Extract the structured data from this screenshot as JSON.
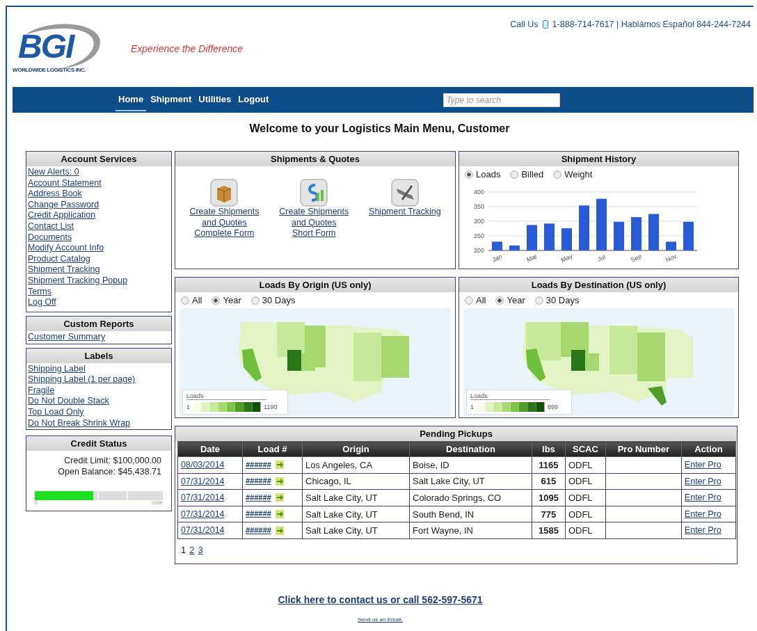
{
  "header": {
    "logo_text": "BGI",
    "logo_subtitle": "WORLDWIDE LOGISTICS INC.",
    "tagline": "Experience the Difference",
    "call_label": "Call Us",
    "phone": "1-888-714-7617 | Hablámos Español 844-244-7244"
  },
  "nav": {
    "items": [
      {
        "label": "Home",
        "selected": true
      },
      {
        "label": "Shipment",
        "selected": false
      },
      {
        "label": "Utilities",
        "selected": false
      },
      {
        "label": "Logout",
        "selected": false
      }
    ],
    "search": {
      "placeholder": "Type to search"
    }
  },
  "welcome": "Welcome to your Logistics Main Menu, Customer",
  "account_services": {
    "title": "Account Services",
    "links": [
      "New Alerts: 0 ",
      "Account Statement",
      "Address Book",
      "Change Password",
      "Credit Application",
      "Contact List",
      "Documents",
      "Modify Account Info",
      "Product Catalog",
      "Shipment Tracking",
      "Shipment Tracking Popup",
      "Terms",
      "Log Off"
    ]
  },
  "custom_reports": {
    "title": "Custom Reports",
    "links": [
      "Customer Summary"
    ]
  },
  "labels": {
    "title": "Labels",
    "links": [
      "Shipping Label",
      "Shipping Label (1 per page)",
      "Fragile",
      "Do Not Double Stack",
      "Top Load Only",
      "Do Not Break Shrink Wrap"
    ]
  },
  "credit_status": {
    "title": "Credit Status",
    "credit_limit": "Credit Limit: $100,000.00",
    "open_balance": "Open Balance: $45,438.71",
    "level": 0.454,
    "min_label": "0",
    "max_label": "100K"
  },
  "shipments_quotes": {
    "title": "Shipments & Quotes",
    "actions": [
      {
        "kind": "box",
        "lines": [
          "Create Shipments",
          "and Quotes",
          "Complete Form"
        ]
      },
      {
        "kind": "money",
        "lines": [
          "Create Shipments",
          "and Quotes",
          "Short Form"
        ]
      },
      {
        "kind": "tracking",
        "lines": [
          "Shipment Tracking"
        ]
      }
    ]
  },
  "shipment_history": {
    "title": "Shipment History",
    "options": [
      {
        "label": "Loads",
        "selected": true
      },
      {
        "label": "Billed",
        "selected": false
      },
      {
        "label": "Weight",
        "selected": false
      }
    ],
    "chart_data": {
      "type": "bar",
      "categories": [
        "Jan",
        null,
        "Mar",
        null,
        "May",
        null,
        "Jul",
        null,
        "Sep",
        null,
        "Nov",
        null
      ],
      "series": [
        {
          "color": "#2a5bd7",
          "values": [
            230,
            217,
            287,
            292,
            276,
            354,
            377,
            298,
            314,
            325,
            230,
            298
          ]
        }
      ],
      "ylim": [
        200,
        400
      ],
      "yticks": [
        200,
        250,
        300,
        350,
        400
      ],
      "grid": true
    }
  },
  "maps": [
    {
      "title": "Loads By Origin (US only)",
      "options": [
        {
          "label": "All",
          "selected": false
        },
        {
          "label": "Year",
          "selected": true
        },
        {
          "label": "30 Days",
          "selected": false
        }
      ],
      "legend": {
        "title": "Loads",
        "min": "1",
        "max": "1190"
      }
    },
    {
      "title": "Loads By Destination (US only)",
      "options": [
        {
          "label": "All",
          "selected": false
        },
        {
          "label": "Year",
          "selected": true
        },
        {
          "label": "30 Days",
          "selected": false
        }
      ],
      "legend": {
        "title": "Loads",
        "min": "1",
        "max": "899"
      }
    }
  ],
  "pending_pickups": {
    "title": "Pending Pickups",
    "columns": [
      "Date",
      "Load #",
      "Origin",
      "Destination",
      "lbs",
      "SCAC",
      "Pro Number",
      "Action"
    ],
    "rows": [
      {
        "date": "08/03/2014",
        "load": "######",
        "origin": "Los Angeles, CA",
        "destination": "Boise, ID",
        "lbs": "1165",
        "scac": "ODFL",
        "action": "Enter Pro"
      },
      {
        "date": "07/31/2014",
        "load": "######",
        "origin": "Chicago, IL",
        "destination": "Salt Lake City, UT",
        "lbs": "615",
        "scac": "ODFL",
        "action": "Enter Pro"
      },
      {
        "date": "07/31/2014",
        "load": "######",
        "origin": "Salt Lake City, UT",
        "destination": "Colorado Springs, CO",
        "lbs": "1095",
        "scac": "ODFL",
        "action": "Enter Pro"
      },
      {
        "date": "07/31/2014",
        "load": "######",
        "origin": "Salt Lake City, UT",
        "destination": "South Bend, IN",
        "lbs": "775",
        "scac": "ODFL",
        "action": "Enter Pro"
      },
      {
        "date": "07/31/2014",
        "load": "######",
        "origin": "Salt Lake City, UT",
        "destination": "Fort Wayne, IN",
        "lbs": "1585",
        "scac": "ODFL",
        "action": "Enter Pro"
      }
    ],
    "pages": [
      {
        "label": "1",
        "selected": true
      },
      {
        "label": "2",
        "selected": false
      },
      {
        "label": "3",
        "selected": false
      }
    ]
  },
  "footer": {
    "contact": "Click here to contact us or call 562-597-5671",
    "email": "Send us an Email."
  }
}
